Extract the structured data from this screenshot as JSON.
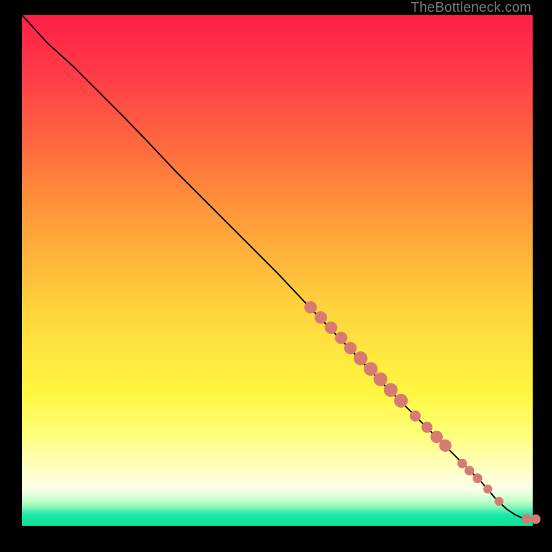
{
  "watermark": "TheBottleneck.com",
  "chart_data": {
    "type": "line",
    "title": "",
    "xlabel": "",
    "ylabel": "",
    "xlim": [
      0,
      1
    ],
    "ylim": [
      0,
      1
    ],
    "annotations": [],
    "gradient_stops": [
      {
        "pos": 0.0,
        "color": "#ff1f48"
      },
      {
        "pos": 0.12,
        "color": "#ff3d48"
      },
      {
        "pos": 0.26,
        "color": "#ff6a3f"
      },
      {
        "pos": 0.36,
        "color": "#ff8f3a"
      },
      {
        "pos": 0.48,
        "color": "#ffb63a"
      },
      {
        "pos": 0.58,
        "color": "#ffd53c"
      },
      {
        "pos": 0.66,
        "color": "#ffe63e"
      },
      {
        "pos": 0.74,
        "color": "#fff640"
      },
      {
        "pos": 0.82,
        "color": "#ffff7a"
      },
      {
        "pos": 0.905,
        "color": "#ffffd4"
      },
      {
        "pos": 0.93,
        "color": "#f6ffe6"
      },
      {
        "pos": 0.95,
        "color": "#c8ffcf"
      },
      {
        "pos": 0.963,
        "color": "#8af7b5"
      },
      {
        "pos": 0.972,
        "color": "#45edb8"
      },
      {
        "pos": 0.978,
        "color": "#1ee6aa"
      },
      {
        "pos": 0.983,
        "color": "#18e4a4"
      },
      {
        "pos": 0.99,
        "color": "#12e29e"
      },
      {
        "pos": 1.0,
        "color": "#0fe19b"
      }
    ],
    "series": [
      {
        "name": "curve",
        "type": "line",
        "color": "#000000",
        "points": [
          {
            "x": 0.0,
            "y": 1.0
          },
          {
            "x": 0.05,
            "y": 0.945
          },
          {
            "x": 0.1,
            "y": 0.9
          },
          {
            "x": 0.15,
            "y": 0.85
          },
          {
            "x": 0.2,
            "y": 0.8
          },
          {
            "x": 0.25,
            "y": 0.748
          },
          {
            "x": 0.3,
            "y": 0.695
          },
          {
            "x": 0.35,
            "y": 0.645
          },
          {
            "x": 0.4,
            "y": 0.595
          },
          {
            "x": 0.45,
            "y": 0.545
          },
          {
            "x": 0.5,
            "y": 0.495
          },
          {
            "x": 0.55,
            "y": 0.442
          },
          {
            "x": 0.6,
            "y": 0.39
          },
          {
            "x": 0.65,
            "y": 0.338
          },
          {
            "x": 0.7,
            "y": 0.285
          },
          {
            "x": 0.75,
            "y": 0.235
          },
          {
            "x": 0.8,
            "y": 0.185
          },
          {
            "x": 0.85,
            "y": 0.135
          },
          {
            "x": 0.9,
            "y": 0.085
          },
          {
            "x": 0.93,
            "y": 0.05
          },
          {
            "x": 0.95,
            "y": 0.032
          },
          {
            "x": 0.965,
            "y": 0.022
          },
          {
            "x": 0.98,
            "y": 0.015
          },
          {
            "x": 0.995,
            "y": 0.013
          },
          {
            "x": 1.01,
            "y": 0.013
          }
        ]
      },
      {
        "name": "markers",
        "type": "scatter",
        "color": "#d87a72",
        "points": [
          {
            "x": 0.565,
            "y": 0.428,
            "r": 9
          },
          {
            "x": 0.585,
            "y": 0.408,
            "r": 9
          },
          {
            "x": 0.605,
            "y": 0.388,
            "r": 9
          },
          {
            "x": 0.625,
            "y": 0.368,
            "r": 9
          },
          {
            "x": 0.643,
            "y": 0.348,
            "r": 9
          },
          {
            "x": 0.663,
            "y": 0.328,
            "r": 10
          },
          {
            "x": 0.683,
            "y": 0.307,
            "r": 10
          },
          {
            "x": 0.702,
            "y": 0.287,
            "r": 10
          },
          {
            "x": 0.722,
            "y": 0.266,
            "r": 10
          },
          {
            "x": 0.742,
            "y": 0.245,
            "r": 10
          },
          {
            "x": 0.77,
            "y": 0.215,
            "r": 8
          },
          {
            "x": 0.793,
            "y": 0.193,
            "r": 8
          },
          {
            "x": 0.812,
            "y": 0.174,
            "r": 9
          },
          {
            "x": 0.829,
            "y": 0.157,
            "r": 9
          },
          {
            "x": 0.862,
            "y": 0.122,
            "r": 7
          },
          {
            "x": 0.876,
            "y": 0.108,
            "r": 7
          },
          {
            "x": 0.892,
            "y": 0.093,
            "r": 7
          },
          {
            "x": 0.912,
            "y": 0.072,
            "r": 6.5
          },
          {
            "x": 0.934,
            "y": 0.048,
            "r": 6.5
          },
          {
            "x": 0.988,
            "y": 0.014,
            "r": 7
          },
          {
            "x": 1.006,
            "y": 0.013,
            "r": 7
          }
        ]
      }
    ]
  }
}
